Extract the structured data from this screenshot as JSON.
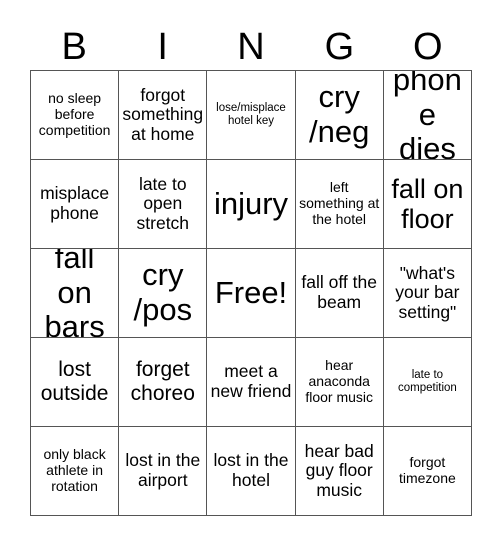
{
  "card": {
    "title": "BINGO",
    "header_letters": [
      "B",
      "I",
      "N",
      "G",
      "O"
    ],
    "grid_size": "5x5",
    "colors": {
      "background": "#ffffff",
      "text": "#000000",
      "border": "#555555"
    },
    "free_space": {
      "label": "Free!",
      "row": 3,
      "column": 3
    },
    "rows": [
      [
        {
          "text": "no sleep before competition",
          "size": "s"
        },
        {
          "text": "forgot something at home",
          "size": "m"
        },
        {
          "text": "lose/misplace hotel key",
          "size": "xs"
        },
        {
          "text": "cry /neg",
          "size": "xxl"
        },
        {
          "text": "phone dies",
          "size": "xxl"
        }
      ],
      [
        {
          "text": "misplace phone",
          "size": "m"
        },
        {
          "text": "late to open stretch",
          "size": "m"
        },
        {
          "text": "injury",
          "size": "xxl"
        },
        {
          "text": "left something at the hotel",
          "size": "s"
        },
        {
          "text": "fall on floor",
          "size": "xl"
        }
      ],
      [
        {
          "text": "fall on bars",
          "size": "xxl"
        },
        {
          "text": "cry /pos",
          "size": "xxl"
        },
        {
          "text": "Free!",
          "size": "xxl"
        },
        {
          "text": "fall off the beam",
          "size": "m"
        },
        {
          "text": "\"what's your bar setting\"",
          "size": "m"
        }
      ],
      [
        {
          "text": "lost outside",
          "size": "l"
        },
        {
          "text": "forget choreo",
          "size": "l"
        },
        {
          "text": "meet a new friend",
          "size": "m"
        },
        {
          "text": "hear anaconda floor music",
          "size": "s"
        },
        {
          "text": "late to competition",
          "size": "xs"
        }
      ],
      [
        {
          "text": "only black athlete in rotation",
          "size": "s"
        },
        {
          "text": "lost in the airport",
          "size": "m"
        },
        {
          "text": "lost in the hotel",
          "size": "m"
        },
        {
          "text": "hear bad guy floor music",
          "size": "m"
        },
        {
          "text": "forgot timezone",
          "size": "s"
        }
      ]
    ]
  }
}
